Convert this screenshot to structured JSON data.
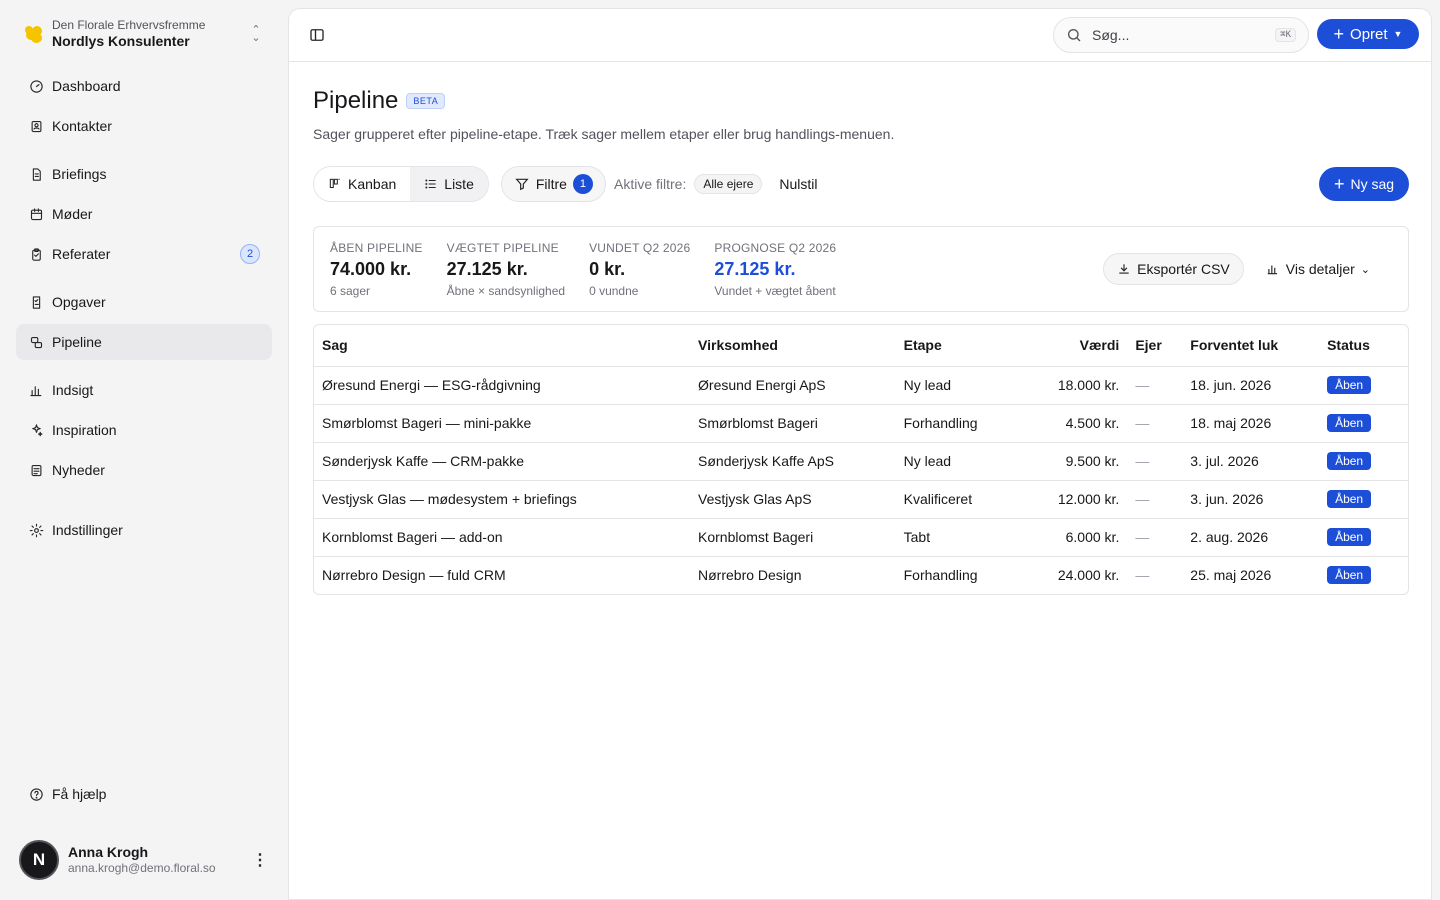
{
  "org": {
    "parent": "Den Florale Erhvervsfremme",
    "name": "Nordlys Konsulenter"
  },
  "sidebar": {
    "groups": [
      [
        {
          "label": "Dashboard",
          "icon": "dashboard-icon"
        },
        {
          "label": "Kontakter",
          "icon": "contacts-icon"
        }
      ],
      [
        {
          "label": "Briefings",
          "icon": "document-icon"
        },
        {
          "label": "Møder",
          "icon": "calendar-icon"
        },
        {
          "label": "Referater",
          "icon": "clipboard-icon",
          "badge": "2"
        }
      ],
      [
        {
          "label": "Opgaver",
          "icon": "tasks-icon"
        },
        {
          "label": "Pipeline",
          "icon": "pipeline-icon",
          "active": true
        }
      ],
      [
        {
          "label": "Indsigt",
          "icon": "bar-chart-icon"
        },
        {
          "label": "Inspiration",
          "icon": "sparkles-icon"
        },
        {
          "label": "Nyheder",
          "icon": "newspaper-icon"
        }
      ],
      [
        {
          "label": "Indstillinger",
          "icon": "gear-icon"
        }
      ]
    ],
    "help": "Få hjælp"
  },
  "user": {
    "initial": "N",
    "name": "Anna Krogh",
    "email": "anna.krogh@demo.floral.so"
  },
  "topbar": {
    "search_placeholder": "Søg...",
    "search_shortcut": "⌘K",
    "create_label": "Opret"
  },
  "page": {
    "title": "Pipeline",
    "badge": "BETA",
    "subtitle": "Sager grupperet efter pipeline-etape. Træk sager mellem etaper eller brug handlings-menuen."
  },
  "toolbar": {
    "view_kanban": "Kanban",
    "view_list": "Liste",
    "filters_label": "Filtre",
    "filters_count": "1",
    "active_filters_label": "Aktive filtre:",
    "active_filter_chip": "Alle ejere",
    "reset_label": "Nulstil",
    "new_deal_label": "Ny sag"
  },
  "stats": [
    {
      "label": "ÅBEN PIPELINE",
      "value": "74.000 kr.",
      "sub": "6 sager"
    },
    {
      "label": "VÆGTET PIPELINE",
      "value": "27.125 kr.",
      "sub": "Åbne × sandsynlighed"
    },
    {
      "label": "VUNDET Q2 2026",
      "value": "0 kr.",
      "sub": "0 vundne"
    },
    {
      "label": "PROGNOSE Q2 2026",
      "value": "27.125 kr.",
      "sub": "Vundet + vægtet åbent",
      "highlight": true
    }
  ],
  "stats_actions": {
    "export_label": "Eksportér CSV",
    "details_label": "Vis detaljer"
  },
  "table": {
    "columns": [
      "Sag",
      "Virksomhed",
      "Etape",
      "Værdi",
      "Ejer",
      "Forventet luk",
      "Status"
    ],
    "rows": [
      {
        "deal": "Øresund Energi — ESG-rådgivning",
        "company": "Øresund Energi ApS",
        "stage": "Ny lead",
        "value": "18.000 kr.",
        "owner": "—",
        "close": "18. jun. 2026",
        "status": "Åben"
      },
      {
        "deal": "Smørblomst Bageri — mini-pakke",
        "company": "Smørblomst Bageri",
        "stage": "Forhandling",
        "value": "4.500 kr.",
        "owner": "—",
        "close": "18. maj 2026",
        "status": "Åben"
      },
      {
        "deal": "Sønderjysk Kaffe — CRM-pakke",
        "company": "Sønderjysk Kaffe ApS",
        "stage": "Ny lead",
        "value": "9.500 kr.",
        "owner": "—",
        "close": "3. jul. 2026",
        "status": "Åben"
      },
      {
        "deal": "Vestjysk Glas — mødesystem + briefings",
        "company": "Vestjysk Glas ApS",
        "stage": "Kvalificeret",
        "value": "12.000 kr.",
        "owner": "—",
        "close": "3. jun. 2026",
        "status": "Åben"
      },
      {
        "deal": "Kornblomst Bageri — add-on",
        "company": "Kornblomst Bageri",
        "stage": "Tabt",
        "value": "6.000 kr.",
        "owner": "—",
        "close": "2. aug. 2026",
        "status": "Åben"
      },
      {
        "deal": "Nørrebro Design — fuld CRM",
        "company": "Nørrebro Design",
        "stage": "Forhandling",
        "value": "24.000 kr.",
        "owner": "—",
        "close": "25. maj 2026",
        "status": "Åben"
      }
    ]
  },
  "colors": {
    "accent": "#1d4ed8",
    "sidebar_bg": "#f4f4f5",
    "logo": "#f5c400"
  }
}
